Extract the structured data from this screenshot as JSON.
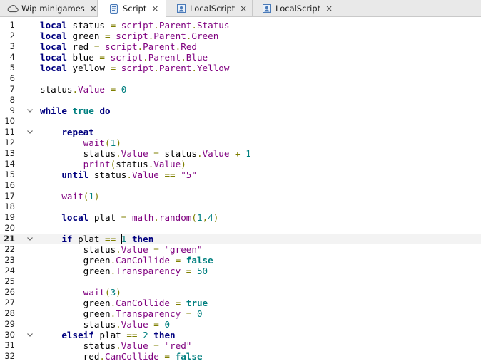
{
  "tabs": [
    {
      "label": "Wip minigames",
      "icon": "cloud-icon",
      "active": false
    },
    {
      "label": "Script",
      "icon": "script-icon",
      "active": true
    },
    {
      "label": "LocalScript",
      "icon": "local-script-icon",
      "active": false
    },
    {
      "label": "LocalScript",
      "icon": "local-script-icon",
      "active": false
    }
  ],
  "close_glyph": "×",
  "current_line": 21,
  "colors": {
    "keyword": "#00007f",
    "boolean": "#007f7f",
    "identifier": "#7f007f",
    "number": "#007f7f",
    "string": "#7f007f",
    "operator": "#7f7f00"
  },
  "lines": [
    {
      "n": "1",
      "fold": false,
      "tokens": [
        [
          "kw",
          "local"
        ],
        [
          "plain",
          " status "
        ],
        [
          "op",
          "="
        ],
        [
          "plain",
          " "
        ],
        [
          "id",
          "script"
        ],
        [
          "op",
          "."
        ],
        [
          "id",
          "Parent"
        ],
        [
          "op",
          "."
        ],
        [
          "id",
          "Status"
        ]
      ]
    },
    {
      "n": "2",
      "fold": false,
      "tokens": [
        [
          "kw",
          "local"
        ],
        [
          "plain",
          " green "
        ],
        [
          "op",
          "="
        ],
        [
          "plain",
          " "
        ],
        [
          "id",
          "script"
        ],
        [
          "op",
          "."
        ],
        [
          "id",
          "Parent"
        ],
        [
          "op",
          "."
        ],
        [
          "id",
          "Green"
        ]
      ]
    },
    {
      "n": "3",
      "fold": false,
      "tokens": [
        [
          "kw",
          "local"
        ],
        [
          "plain",
          " red "
        ],
        [
          "op",
          "="
        ],
        [
          "plain",
          " "
        ],
        [
          "id",
          "script"
        ],
        [
          "op",
          "."
        ],
        [
          "id",
          "Parent"
        ],
        [
          "op",
          "."
        ],
        [
          "id",
          "Red"
        ]
      ]
    },
    {
      "n": "4",
      "fold": false,
      "tokens": [
        [
          "kw",
          "local"
        ],
        [
          "plain",
          " blue "
        ],
        [
          "op",
          "="
        ],
        [
          "plain",
          " "
        ],
        [
          "id",
          "script"
        ],
        [
          "op",
          "."
        ],
        [
          "id",
          "Parent"
        ],
        [
          "op",
          "."
        ],
        [
          "id",
          "Blue"
        ]
      ]
    },
    {
      "n": "5",
      "fold": false,
      "tokens": [
        [
          "kw",
          "local"
        ],
        [
          "plain",
          " yellow "
        ],
        [
          "op",
          "="
        ],
        [
          "plain",
          " "
        ],
        [
          "id",
          "script"
        ],
        [
          "op",
          "."
        ],
        [
          "id",
          "Parent"
        ],
        [
          "op",
          "."
        ],
        [
          "id",
          "Yellow"
        ]
      ]
    },
    {
      "n": "6",
      "fold": false,
      "tokens": []
    },
    {
      "n": "7",
      "fold": false,
      "tokens": [
        [
          "plain",
          "status"
        ],
        [
          "op",
          "."
        ],
        [
          "id",
          "Value"
        ],
        [
          "plain",
          " "
        ],
        [
          "op",
          "="
        ],
        [
          "plain",
          " "
        ],
        [
          "num",
          "0"
        ]
      ]
    },
    {
      "n": "8",
      "fold": false,
      "tokens": []
    },
    {
      "n": "9",
      "fold": true,
      "tokens": [
        [
          "kw",
          "while"
        ],
        [
          "plain",
          " "
        ],
        [
          "bool",
          "true"
        ],
        [
          "plain",
          " "
        ],
        [
          "kw",
          "do"
        ]
      ]
    },
    {
      "n": "10",
      "fold": false,
      "tokens": []
    },
    {
      "n": "11",
      "fold": true,
      "tokens": [
        [
          "plain",
          "    "
        ],
        [
          "kw",
          "repeat"
        ]
      ]
    },
    {
      "n": "12",
      "fold": false,
      "tokens": [
        [
          "plain",
          "        "
        ],
        [
          "id",
          "wait"
        ],
        [
          "op",
          "("
        ],
        [
          "num",
          "1"
        ],
        [
          "op",
          ")"
        ]
      ]
    },
    {
      "n": "13",
      "fold": false,
      "tokens": [
        [
          "plain",
          "        status"
        ],
        [
          "op",
          "."
        ],
        [
          "id",
          "Value"
        ],
        [
          "plain",
          " "
        ],
        [
          "op",
          "="
        ],
        [
          "plain",
          " status"
        ],
        [
          "op",
          "."
        ],
        [
          "id",
          "Value"
        ],
        [
          "plain",
          " "
        ],
        [
          "op",
          "+"
        ],
        [
          "plain",
          " "
        ],
        [
          "num",
          "1"
        ]
      ]
    },
    {
      "n": "14",
      "fold": false,
      "tokens": [
        [
          "plain",
          "        "
        ],
        [
          "id",
          "print"
        ],
        [
          "op",
          "("
        ],
        [
          "plain",
          "status"
        ],
        [
          "op",
          "."
        ],
        [
          "id",
          "Value"
        ],
        [
          "op",
          ")"
        ]
      ]
    },
    {
      "n": "15",
      "fold": false,
      "tokens": [
        [
          "plain",
          "    "
        ],
        [
          "kw",
          "until"
        ],
        [
          "plain",
          " status"
        ],
        [
          "op",
          "."
        ],
        [
          "id",
          "Value"
        ],
        [
          "plain",
          " "
        ],
        [
          "op",
          "=="
        ],
        [
          "plain",
          " "
        ],
        [
          "str",
          "\"5\""
        ]
      ]
    },
    {
      "n": "16",
      "fold": false,
      "tokens": []
    },
    {
      "n": "17",
      "fold": false,
      "tokens": [
        [
          "plain",
          "    "
        ],
        [
          "id",
          "wait"
        ],
        [
          "op",
          "("
        ],
        [
          "num",
          "1"
        ],
        [
          "op",
          ")"
        ]
      ]
    },
    {
      "n": "18",
      "fold": false,
      "tokens": []
    },
    {
      "n": "19",
      "fold": false,
      "tokens": [
        [
          "plain",
          "    "
        ],
        [
          "kw",
          "local"
        ],
        [
          "plain",
          " plat "
        ],
        [
          "op",
          "="
        ],
        [
          "plain",
          " "
        ],
        [
          "id",
          "math"
        ],
        [
          "op",
          "."
        ],
        [
          "id",
          "random"
        ],
        [
          "op",
          "("
        ],
        [
          "num",
          "1"
        ],
        [
          "op",
          ","
        ],
        [
          "num",
          "4"
        ],
        [
          "op",
          ")"
        ]
      ]
    },
    {
      "n": "20",
      "fold": false,
      "tokens": []
    },
    {
      "n": "21",
      "fold": true,
      "tokens": [
        [
          "plain",
          "    "
        ],
        [
          "kw",
          "if"
        ],
        [
          "plain",
          " plat "
        ],
        [
          "op",
          "=="
        ],
        [
          "plain",
          " "
        ],
        [
          "caret",
          ""
        ],
        [
          "num",
          "1"
        ],
        [
          "plain",
          " "
        ],
        [
          "kw",
          "then"
        ]
      ]
    },
    {
      "n": "22",
      "fold": false,
      "tokens": [
        [
          "plain",
          "        status"
        ],
        [
          "op",
          "."
        ],
        [
          "id",
          "Value"
        ],
        [
          "plain",
          " "
        ],
        [
          "op",
          "="
        ],
        [
          "plain",
          " "
        ],
        [
          "str",
          "\"green\""
        ]
      ]
    },
    {
      "n": "23",
      "fold": false,
      "tokens": [
        [
          "plain",
          "        green"
        ],
        [
          "op",
          "."
        ],
        [
          "id",
          "CanCollide"
        ],
        [
          "plain",
          " "
        ],
        [
          "op",
          "="
        ],
        [
          "plain",
          " "
        ],
        [
          "bool",
          "false"
        ]
      ]
    },
    {
      "n": "24",
      "fold": false,
      "tokens": [
        [
          "plain",
          "        green"
        ],
        [
          "op",
          "."
        ],
        [
          "id",
          "Transparency"
        ],
        [
          "plain",
          " "
        ],
        [
          "op",
          "="
        ],
        [
          "plain",
          " "
        ],
        [
          "num",
          "50"
        ]
      ]
    },
    {
      "n": "25",
      "fold": false,
      "tokens": []
    },
    {
      "n": "26",
      "fold": false,
      "tokens": [
        [
          "plain",
          "        "
        ],
        [
          "id",
          "wait"
        ],
        [
          "op",
          "("
        ],
        [
          "num",
          "3"
        ],
        [
          "op",
          ")"
        ]
      ]
    },
    {
      "n": "27",
      "fold": false,
      "tokens": [
        [
          "plain",
          "        green"
        ],
        [
          "op",
          "."
        ],
        [
          "id",
          "CanCollide"
        ],
        [
          "plain",
          " "
        ],
        [
          "op",
          "="
        ],
        [
          "plain",
          " "
        ],
        [
          "bool",
          "true"
        ]
      ]
    },
    {
      "n": "28",
      "fold": false,
      "tokens": [
        [
          "plain",
          "        green"
        ],
        [
          "op",
          "."
        ],
        [
          "id",
          "Transparency"
        ],
        [
          "plain",
          " "
        ],
        [
          "op",
          "="
        ],
        [
          "plain",
          " "
        ],
        [
          "num",
          "0"
        ]
      ]
    },
    {
      "n": "29",
      "fold": false,
      "tokens": [
        [
          "plain",
          "        status"
        ],
        [
          "op",
          "."
        ],
        [
          "id",
          "Value"
        ],
        [
          "plain",
          " "
        ],
        [
          "op",
          "="
        ],
        [
          "plain",
          " "
        ],
        [
          "num",
          "0"
        ]
      ]
    },
    {
      "n": "30",
      "fold": true,
      "tokens": [
        [
          "plain",
          "    "
        ],
        [
          "kw",
          "elseif"
        ],
        [
          "plain",
          " plat "
        ],
        [
          "op",
          "=="
        ],
        [
          "plain",
          " "
        ],
        [
          "num",
          "2"
        ],
        [
          "plain",
          " "
        ],
        [
          "kw",
          "then"
        ]
      ]
    },
    {
      "n": "31",
      "fold": false,
      "tokens": [
        [
          "plain",
          "        status"
        ],
        [
          "op",
          "."
        ],
        [
          "id",
          "Value"
        ],
        [
          "plain",
          " "
        ],
        [
          "op",
          "="
        ],
        [
          "plain",
          " "
        ],
        [
          "str",
          "\"red\""
        ]
      ]
    },
    {
      "n": "32",
      "fold": false,
      "tokens": [
        [
          "plain",
          "        red"
        ],
        [
          "op",
          "."
        ],
        [
          "id",
          "CanCollide"
        ],
        [
          "plain",
          " "
        ],
        [
          "op",
          "="
        ],
        [
          "plain",
          " "
        ],
        [
          "bool",
          "false"
        ]
      ]
    }
  ]
}
